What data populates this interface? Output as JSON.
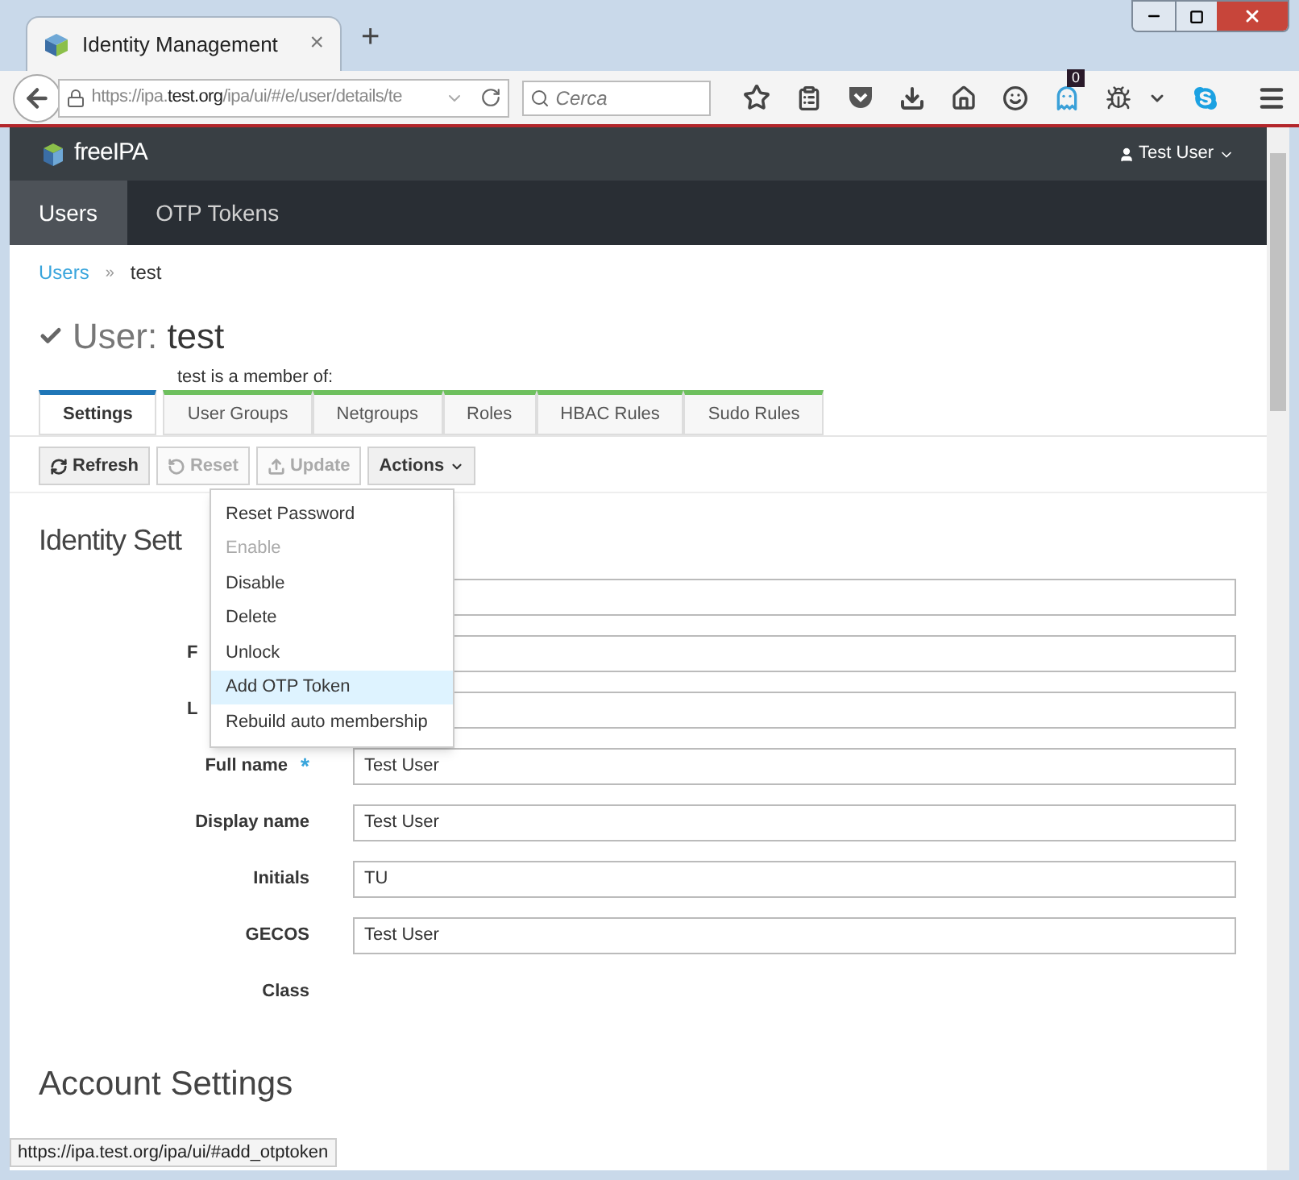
{
  "browser": {
    "tab_title": "Identity Management",
    "tab_close": "×",
    "new_tab": "+",
    "url_prefix": "https://ipa.",
    "url_domain": "test.org",
    "url_rest": "/ipa/ui/#/e/user/details/te",
    "search_placeholder": "Cerca",
    "badge": "0",
    "status_url": "https://ipa.test.org/ipa/ui/#add_otptoken"
  },
  "header": {
    "brand": "freeIPA",
    "user": "Test User"
  },
  "nav": [
    {
      "label": "Users",
      "selected": true
    },
    {
      "label": "OTP Tokens",
      "selected": false
    }
  ],
  "breadcrumb": {
    "link": "Users",
    "sep": "»",
    "current": "test"
  },
  "title": {
    "prefix": "User:",
    "name": "test"
  },
  "member_of": "test is a member of:",
  "tabs": [
    {
      "label": "Settings",
      "selected": true,
      "kind": "settings"
    },
    {
      "label": "User Groups",
      "selected": false,
      "kind": "member"
    },
    {
      "label": "Netgroups",
      "selected": false,
      "kind": "member"
    },
    {
      "label": "Roles",
      "selected": false,
      "kind": "member"
    },
    {
      "label": "HBAC Rules",
      "selected": false,
      "kind": "member"
    },
    {
      "label": "Sudo Rules",
      "selected": false,
      "kind": "member"
    }
  ],
  "buttons": [
    {
      "label": "Refresh",
      "kind": "refresh",
      "disabled": false
    },
    {
      "label": "Reset",
      "kind": "reset",
      "disabled": true
    },
    {
      "label": "Update",
      "kind": "update",
      "disabled": true
    },
    {
      "label": "Actions",
      "kind": "actions",
      "disabled": false
    }
  ],
  "menu": [
    {
      "label": "Reset Password",
      "disabled": false,
      "selected": false
    },
    {
      "label": "Enable",
      "disabled": true,
      "selected": false
    },
    {
      "label": "Disable",
      "disabled": false,
      "selected": false
    },
    {
      "label": "Delete",
      "disabled": false,
      "selected": false
    },
    {
      "label": "Unlock",
      "disabled": false,
      "selected": false
    },
    {
      "label": "Add OTP Token",
      "disabled": false,
      "selected": true
    },
    {
      "label": "Rebuild auto membership",
      "disabled": false,
      "selected": false
    }
  ],
  "section_title": "Identity Sett",
  "fields": [
    {
      "kind": "input"
    },
    {
      "kind": "input",
      "label": "F",
      "covered": true
    },
    {
      "kind": "input",
      "label": "L",
      "covered": true
    },
    {
      "kind": "input",
      "label": "Full name",
      "required_mark": "*",
      "value": "Test User"
    },
    {
      "kind": "input",
      "label": "Display name",
      "value": "Test User"
    },
    {
      "kind": "input",
      "label": "Initials",
      "value": "TU"
    },
    {
      "kind": "input",
      "label": "GECOS",
      "value": "Test User"
    },
    {
      "kind": "text",
      "label": "Class"
    }
  ],
  "section2_title": "Account Settings"
}
